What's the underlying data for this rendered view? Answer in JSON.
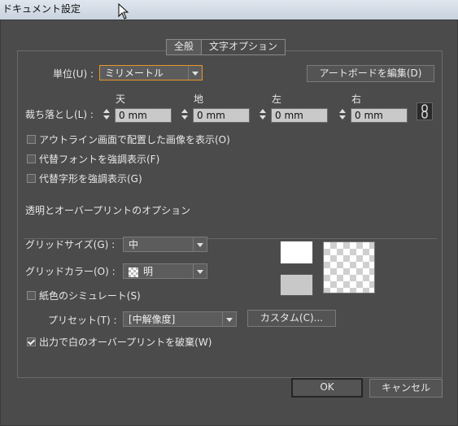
{
  "window": {
    "title": "ドキュメント設定"
  },
  "tabs": [
    {
      "label": "全般",
      "active": true
    },
    {
      "label": "文字オプション",
      "active": false
    }
  ],
  "units": {
    "label": "単位(U) :",
    "value": "ミリメートル"
  },
  "edit_artboards_button": "アートボードを編集(D)",
  "bleed": {
    "label": "裁ち落とし(L) :",
    "headers": [
      "天",
      "地",
      "左",
      "右"
    ],
    "values": [
      "0 mm",
      "0 mm",
      "0 mm",
      "0 mm"
    ],
    "link_icon": "chain-link-icon"
  },
  "checkboxes": [
    {
      "label": "アウトライン画面で配置した画像を表示(O)",
      "checked": false
    },
    {
      "label": "代替フォントを強調表示(F)",
      "checked": false
    },
    {
      "label": "代替字形を強調表示(G)",
      "checked": false
    }
  ],
  "transparency": {
    "section_title": "透明とオーバープリントのオプション",
    "grid_size": {
      "label": "グリッドサイズ(G) :",
      "value": "中"
    },
    "grid_color": {
      "label": "グリッドカラー(O) :",
      "value": "明"
    },
    "simulate_paper": {
      "label": "紙色のシミュレート(S)",
      "checked": false
    },
    "preset": {
      "label": "プリセット(T) :",
      "value": "[中解像度]"
    },
    "custom_button": "カスタム(C)...",
    "discard_overprint": {
      "label": "出力で白のオーバープリントを破棄(W)",
      "checked": true
    }
  },
  "footer": {
    "ok": "OK",
    "cancel": "キャンセル"
  },
  "colors": {
    "accent": "#e8952a",
    "dialog_bg": "#4b4b4b"
  }
}
